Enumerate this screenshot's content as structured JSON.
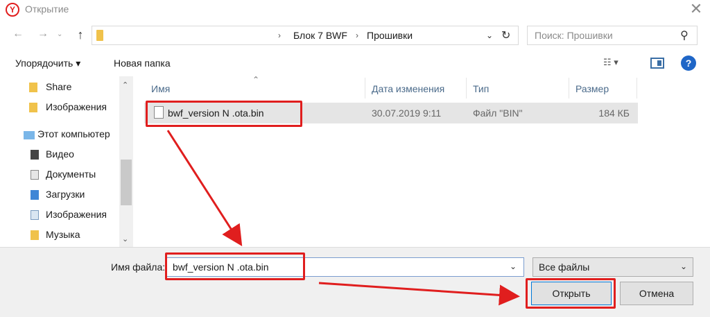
{
  "window": {
    "title": "Открытие",
    "app_icon_letter": "Y",
    "close_glyph": "✕"
  },
  "nav": {
    "back_glyph": "←",
    "forward_glyph": "→",
    "recent_glyph": "⌄",
    "up_glyph": "↑",
    "breadcrumbs": [
      "Блок 7 BWF",
      "Прошивки"
    ],
    "crumb_separator": "›",
    "dropdown_glyph": "⌄",
    "refresh_glyph": "↻"
  },
  "search": {
    "placeholder": "Поиск: Прошивки",
    "icon_glyph": "⚲"
  },
  "toolbar": {
    "organize_label": "Упорядочить ▾",
    "new_folder_label": "Новая папка",
    "view_label": "☷ ▾",
    "help_label": "?"
  },
  "sidebar": {
    "items": [
      {
        "label": "Share",
        "icon": "folder-icon"
      },
      {
        "label": "Изображения",
        "icon": "folder-icon"
      },
      {
        "label": "Этот компьютер",
        "icon": "computer-icon"
      },
      {
        "label": "Видео",
        "icon": "video-icon"
      },
      {
        "label": "Документы",
        "icon": "documents-icon"
      },
      {
        "label": "Загрузки",
        "icon": "downloads-icon"
      },
      {
        "label": "Изображения",
        "icon": "pictures-icon"
      },
      {
        "label": "Музыка",
        "icon": "music-icon"
      }
    ],
    "scroll_up_glyph": "⌃",
    "scroll_down_glyph": "⌄"
  },
  "file_list": {
    "columns": [
      "Имя",
      "Дата изменения",
      "Тип",
      "Размер"
    ],
    "sort_glyph": "⌃",
    "rows": [
      {
        "name": "bwf_version N .ota.bin",
        "date": "30.07.2019 9:11",
        "type": "Файл \"BIN\"",
        "size": "184 КБ"
      }
    ]
  },
  "footer": {
    "filename_label": "Имя файла:",
    "filename_value": "bwf_version N .ota.bin",
    "filename_dropdown_glyph": "⌄",
    "filetype_value": "Все файлы",
    "filetype_arrow_glyph": "⌄",
    "open_label": "Открыть",
    "cancel_label": "Отмена"
  },
  "colors": {
    "highlight": "#e01e1e",
    "accent": "#0078d7"
  }
}
